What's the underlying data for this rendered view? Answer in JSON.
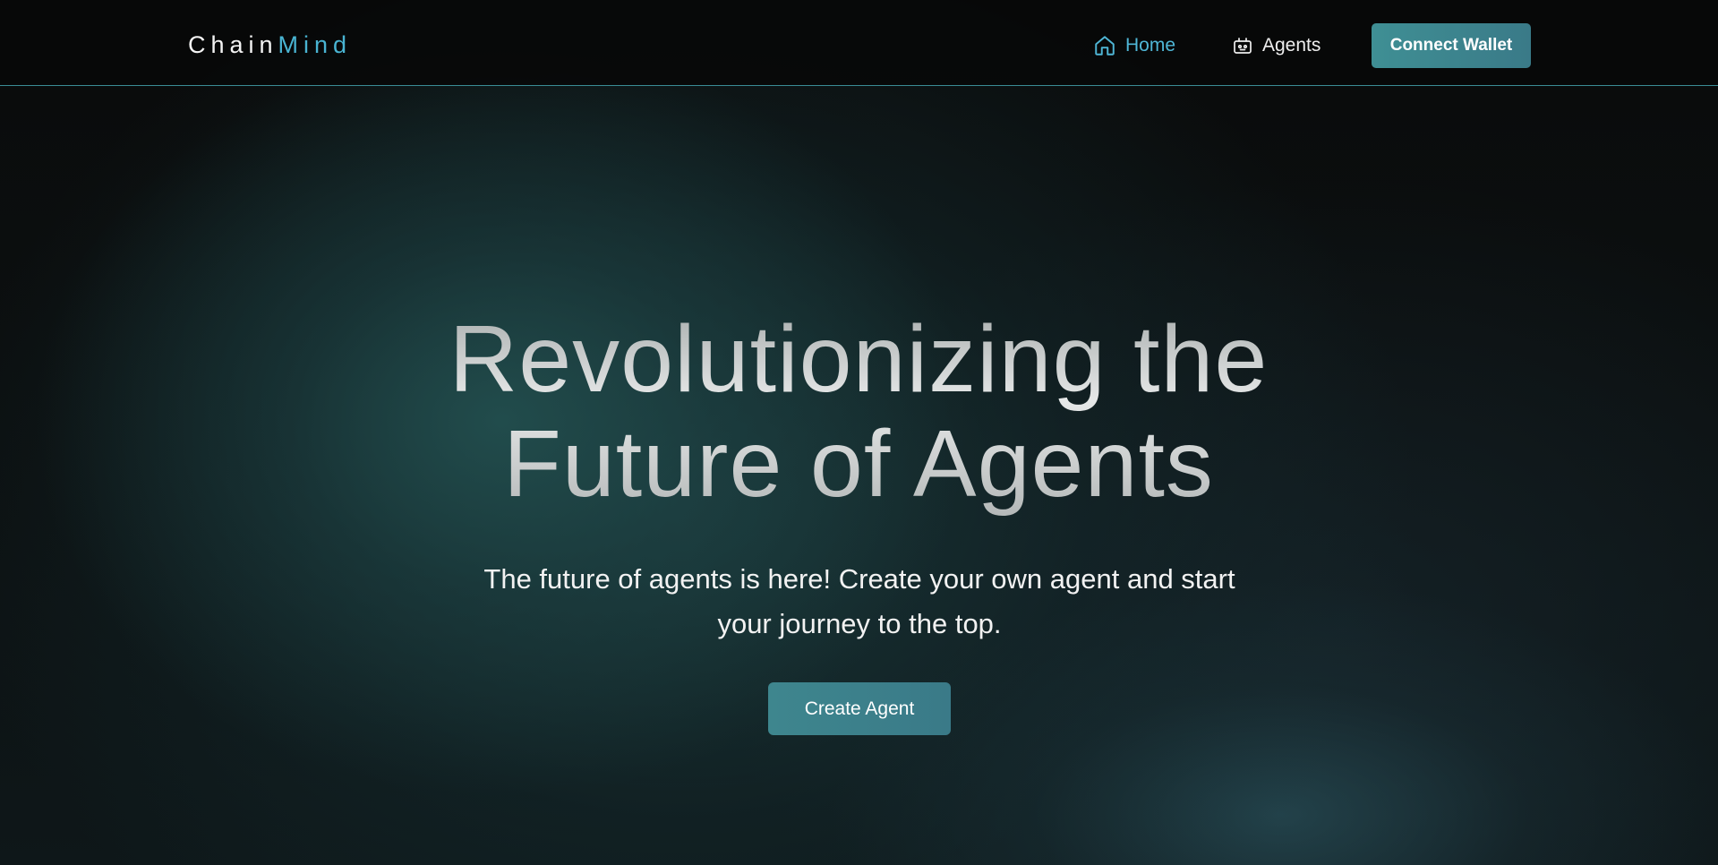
{
  "header": {
    "logo_part1": "Chain",
    "logo_part2": "Mind",
    "nav": {
      "home_label": "Home",
      "home_icon": "home-icon",
      "agents_label": "Agents",
      "agents_icon": "robot-icon"
    },
    "connect_wallet_label": "Connect Wallet"
  },
  "hero": {
    "title_line1": "Revolutionizing the",
    "title_line2": "Future of Agents",
    "subtitle_line1": "The future of agents is here! Create your own agent and start",
    "subtitle_line2": "your journey to the top.",
    "cta_label": "Create Agent"
  },
  "colors": {
    "accent": "#49b4d2",
    "button": "#3f8f94",
    "nav_border": "#3a8c95",
    "background": "#070808"
  }
}
